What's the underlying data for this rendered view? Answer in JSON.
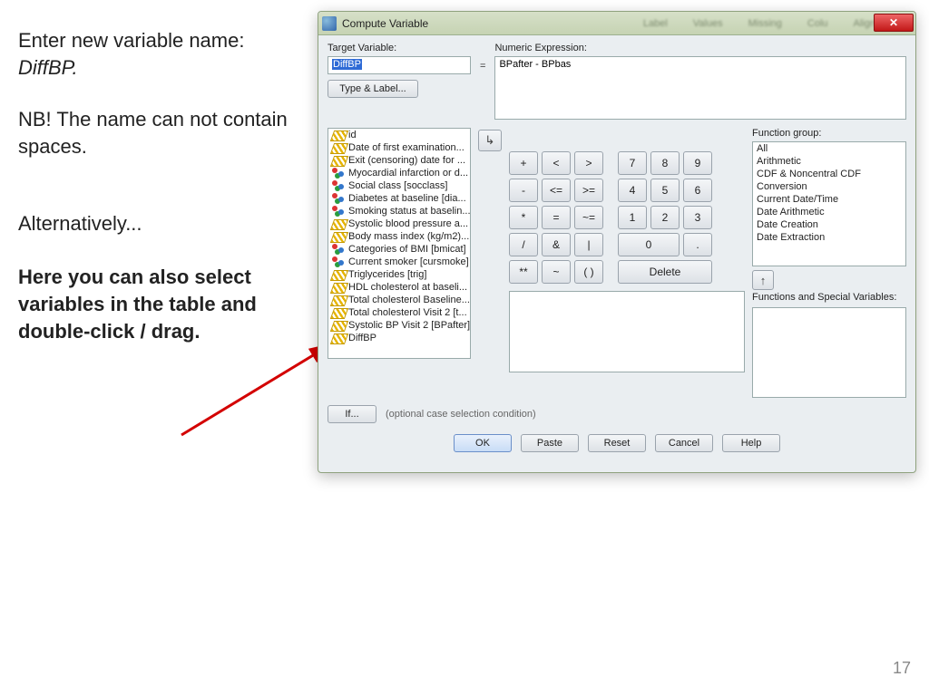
{
  "slide": {
    "line1a": "Enter new variable name: ",
    "line1b": "DiffBP.",
    "line2": "NB! The name can not contain spaces.",
    "line3": "Alternatively...",
    "line4": "Here you can also select variables in the table and double-click / drag.",
    "pagenum": "17"
  },
  "dialog": {
    "title": "Compute Variable",
    "bg_tabs": [
      "Label",
      "Values",
      "Missing",
      "Colu",
      "Align"
    ],
    "close_glyph": "✕",
    "labels": {
      "target": "Target Variable:",
      "numeric": "Numeric Expression:",
      "func_group": "Function group:",
      "func_vars": "Functions and Special Variables:"
    },
    "target_value": "DiffBP",
    "expression": "BPafter - BPbas",
    "type_label_btn": "Type & Label...",
    "equals": "=",
    "move_glyph": "↳",
    "variables": [
      {
        "icon": "scale",
        "label": "id"
      },
      {
        "icon": "scale",
        "label": "Date of first examination..."
      },
      {
        "icon": "scale",
        "label": "Exit (censoring) date for ..."
      },
      {
        "icon": "nominal",
        "label": "Myocardial infarction or d..."
      },
      {
        "icon": "nominal",
        "label": "Social class [socclass]"
      },
      {
        "icon": "nominal",
        "label": "Diabetes at baseline [dia..."
      },
      {
        "icon": "nominal",
        "label": "Smoking status at baselin..."
      },
      {
        "icon": "scale",
        "label": "Systolic blood pressure a..."
      },
      {
        "icon": "scale",
        "label": "Body mass index (kg/m2)..."
      },
      {
        "icon": "nominal",
        "label": "Categories of BMI [bmicat]"
      },
      {
        "icon": "nominal",
        "label": "Current smoker [cursmoke]"
      },
      {
        "icon": "scale",
        "label": "Triglycerides [trig]"
      },
      {
        "icon": "scale",
        "label": "HDL cholesterol at baseli..."
      },
      {
        "icon": "scale",
        "label": "Total cholesterol Baseline..."
      },
      {
        "icon": "scale",
        "label": "Total cholesterol Visit 2 [t..."
      },
      {
        "icon": "scale",
        "label": "Systolic BP Visit 2 [BPafter]"
      },
      {
        "icon": "scale",
        "label": "DiffBP"
      }
    ],
    "keys": {
      "r0": [
        "+",
        "<",
        ">",
        "7",
        "8",
        "9"
      ],
      "r1": [
        "-",
        "<=",
        ">=",
        "4",
        "5",
        "6"
      ],
      "r2": [
        "*",
        "=",
        "~=",
        "1",
        "2",
        "3"
      ],
      "r3": [
        "/",
        "&",
        "|",
        "0",
        "."
      ],
      "r4": [
        "**",
        "~",
        "( )",
        "Delete"
      ]
    },
    "function_groups": [
      "All",
      "Arithmetic",
      "CDF & Noncentral CDF",
      "Conversion",
      "Current Date/Time",
      "Date Arithmetic",
      "Date Creation",
      "Date Extraction"
    ],
    "up_glyph": "↑",
    "if_btn": "If...",
    "if_text": "(optional case selection condition)",
    "buttons": {
      "ok": "OK",
      "paste": "Paste",
      "reset": "Reset",
      "cancel": "Cancel",
      "help": "Help"
    }
  }
}
